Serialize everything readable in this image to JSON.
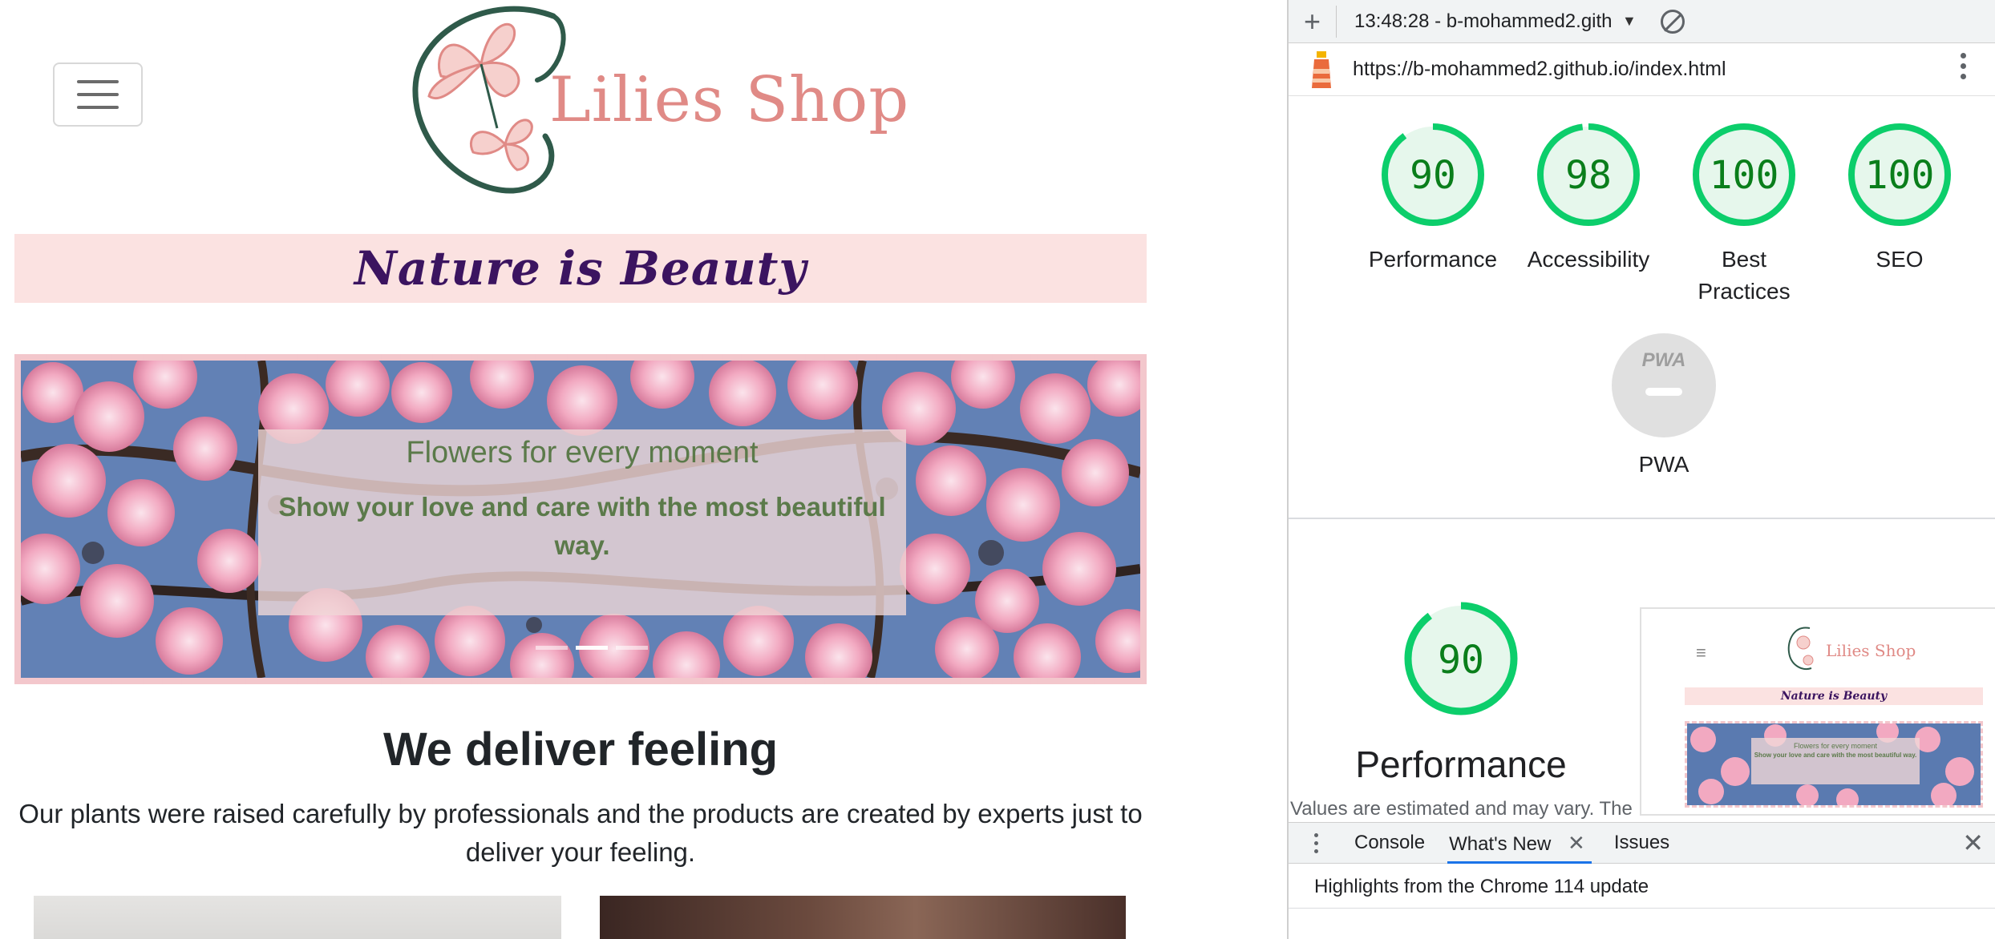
{
  "site": {
    "menu_icon": "hamburger-icon",
    "logo_icon": "lily-logo-icon",
    "logo_text": "Lilies Shop",
    "tagline": "Nature is Beauty",
    "carousel": {
      "title": "Flowers for every moment",
      "text": "Show your love and care with the most beautiful way.",
      "indicators": 3,
      "active_indicator": 1
    },
    "section_heading": "We deliver feeling",
    "section_text": "Our plants were raised carefully by professionals and the products are created by experts just to deliver your feeling."
  },
  "devtools": {
    "toolbar": {
      "new_report_icon": "plus-icon",
      "report_select": "13:48:28 - b-mohammed2.gith",
      "clear_icon": "clear-icon"
    },
    "url": "https://b-mohammed2.github.io/index.html",
    "categories": [
      {
        "name": "Performance",
        "score": 90
      },
      {
        "name": "Accessibility",
        "score": 98
      },
      {
        "name": "Best Practices",
        "score": 100
      },
      {
        "name": "SEO",
        "score": 100
      }
    ],
    "pwa": {
      "name": "PWA",
      "badge": "PWA"
    },
    "performance_section": {
      "score": 90,
      "title": "Performance",
      "note": "Values are estimated and may vary. The"
    },
    "drawer": {
      "tabs": [
        "Console",
        "What's New",
        "Issues"
      ],
      "active_tab": "What's New",
      "content": "Highlights from the Chrome 114 update"
    },
    "colors": {
      "gauge_pass": "#0cce6b",
      "gauge_text": "#0a7e1b",
      "gauge_bg": "#e6f7ec",
      "accent": "#1a73e8"
    }
  }
}
